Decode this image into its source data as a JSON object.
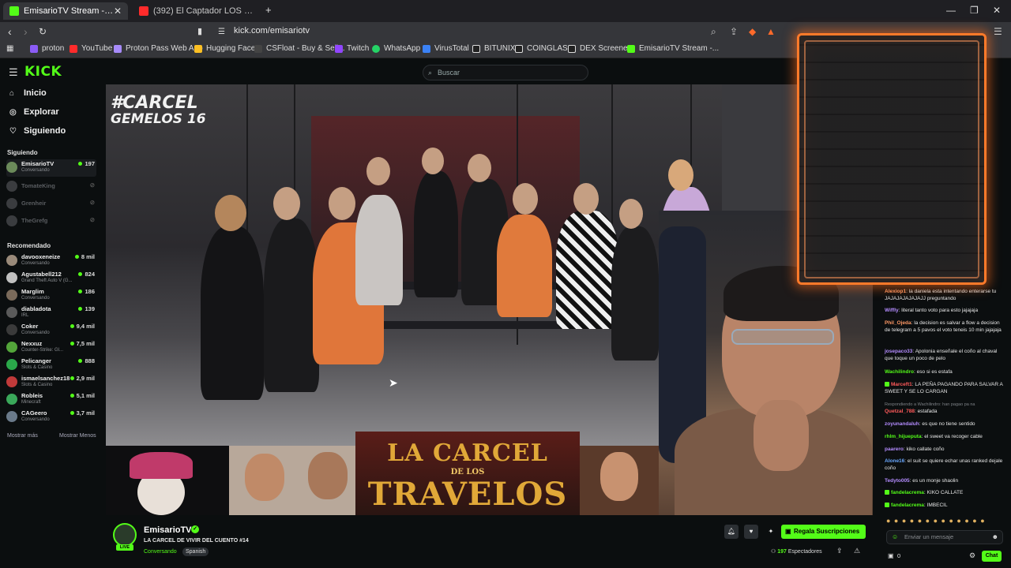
{
  "browser": {
    "tabs": [
      {
        "title": "EmisarioTV Stream - Watch Li",
        "favicon_color": "#53fc18",
        "active": true
      },
      {
        "title": "(392) El Captador LOS NIÑOS NO",
        "favicon_color": "#ff2b2b",
        "active": false
      }
    ],
    "new_tab": "+",
    "url": "kick.com/emisariotv",
    "bookmarks": [
      {
        "label": "proton",
        "color": "#8b5cf6"
      },
      {
        "label": "YouTube",
        "color": "#ff2b2b"
      },
      {
        "label": "Proton Pass Web App",
        "color": "#a78bfa"
      },
      {
        "label": "Hugging Face",
        "color": "#fbbf24"
      },
      {
        "label": "CSFloat - Buy & Sell...",
        "color": "#ffffff"
      },
      {
        "label": "Twitch",
        "color": "#9146ff"
      },
      {
        "label": "WhatsApp",
        "color": "#25d366"
      },
      {
        "label": "VirusTotal",
        "color": "#3b82f6"
      },
      {
        "label": "BITUNIX",
        "color": "#ffffff"
      },
      {
        "label": "COINGLASS",
        "color": "#ffffff"
      },
      {
        "label": "DEX Screener",
        "color": "#ffffff"
      },
      {
        "label": "EmisarioTV Stream -...",
        "color": "#53fc18"
      }
    ]
  },
  "kick": {
    "logo": "KICK",
    "search_placeholder": "Buscar",
    "nav": [
      {
        "label": "Inicio",
        "icon": "home-icon"
      },
      {
        "label": "Explorar",
        "icon": "compass-icon"
      },
      {
        "label": "Siguiendo",
        "icon": "heart-icon"
      }
    ],
    "following_header": "Siguiendo",
    "following": [
      {
        "name": "EmisarioTV",
        "category": "Conversando",
        "viewers": "197",
        "online": true
      },
      {
        "name": "TomateKing",
        "category": "",
        "viewers": "",
        "online": false
      },
      {
        "name": "Grenheir",
        "category": "",
        "viewers": "",
        "online": false
      },
      {
        "name": "TheGrefg",
        "category": "",
        "viewers": "",
        "online": false
      }
    ],
    "recommended_header": "Recomendado",
    "recommended": [
      {
        "name": "davooxeneize",
        "category": "Conversando",
        "viewers": "8 mil"
      },
      {
        "name": "Agustabell212",
        "category": "Grand Theft Auto V (G...",
        "viewers": "824"
      },
      {
        "name": "Marglim",
        "category": "Conversando",
        "viewers": "186"
      },
      {
        "name": "diabladota",
        "category": "IRL",
        "viewers": "139"
      },
      {
        "name": "Coker",
        "category": "Conversando",
        "viewers": "9,4 mil"
      },
      {
        "name": "Nexxuz",
        "category": "Counter-Strike: Gl...",
        "viewers": "7,5 mil"
      },
      {
        "name": "Pelicanger",
        "category": "Slots & Casino",
        "viewers": "888"
      },
      {
        "name": "ismaelsanchez18",
        "category": "Slots & Casino",
        "viewers": "2,9 mil"
      },
      {
        "name": "Robleis",
        "category": "Minecraft",
        "viewers": "5,1 mil"
      },
      {
        "name": "CAGeero",
        "category": "Conversando",
        "viewers": "3,7 mil"
      }
    ],
    "show_more": "Mostrar más",
    "show_less": "Mostrar Menos"
  },
  "video": {
    "hashtag_line1": "#CARCEL",
    "hashtag_line2": "GEMELOS 16",
    "banner_line1": "LA CARCEL",
    "banner_line2": "DE LOS",
    "banner_line3": "TRAVELOS"
  },
  "chat": {
    "messages": [
      {
        "user": "Alexiop1",
        "color": "#ff9966",
        "text": "la daniela esta intentando enterarse tu JAJAJAJAJAJAJJ preguntando"
      },
      {
        "user": "Wiffly",
        "color": "#b48cff",
        "text": "literal tanto voto para esto jajajaja"
      },
      {
        "user": "Phil_Ojeda",
        "color": "#ff9966",
        "text": "la decision es salvar a flow a decision de telegram a 5 pavos el voto teneis 10 min jajajaja"
      },
      {
        "user": "josepaco33",
        "color": "#b48cff",
        "text": "Apolonia enseñale el coño al chaval que toque un poco de pelo"
      },
      {
        "user": "Wachilindro",
        "color": "#53fc18",
        "text": "eso si es estafa"
      },
      {
        "user": "Marceft1",
        "color": "#ff5a5a",
        "text": "LA PEÑA PAGANDO PARA SALVAR A SWEET Y SE LO CARGAN"
      },
      {
        "reply": "Respondiendo a Wachilindro: han pagao pa na"
      },
      {
        "user": "Quetzal_788",
        "color": "#ff5a5a",
        "text": "estafada"
      },
      {
        "user": "zoyunandaluh",
        "color": "#b48cff",
        "text": "es que no tiene sentido"
      },
      {
        "user": "rhlm_hijueputa",
        "color": "#53fc18",
        "text": "el sweet va recoger cable"
      },
      {
        "user": "paarero",
        "color": "#b48cff",
        "text": "kiko callate coño"
      },
      {
        "user": "Alone16",
        "color": "#6aa8ff",
        "text": "el suit se quiere echar unas ranked dejale coño"
      },
      {
        "user": "Tedyto005",
        "color": "#b48cff",
        "text": "es un monje shaolin"
      },
      {
        "user": "fandelacrema",
        "color": "#53fc18",
        "text": "KIKO CALLATE"
      },
      {
        "user": "fandelacrema",
        "color": "#53fc18",
        "text": "IMBECIL"
      }
    ],
    "input_placeholder": "Enviar un mensaje",
    "points": "0",
    "send_label": "Chat"
  },
  "streamer": {
    "name": "EmisarioTV",
    "title": "LA CARCEL DE VIVIR DEL CUENTO #14",
    "category": "Conversando",
    "language": "Spanish",
    "live_label": "LIVE",
    "subscribe_label": "Regala Suscripciones",
    "viewers": "197",
    "viewers_label": "Espectadores"
  }
}
